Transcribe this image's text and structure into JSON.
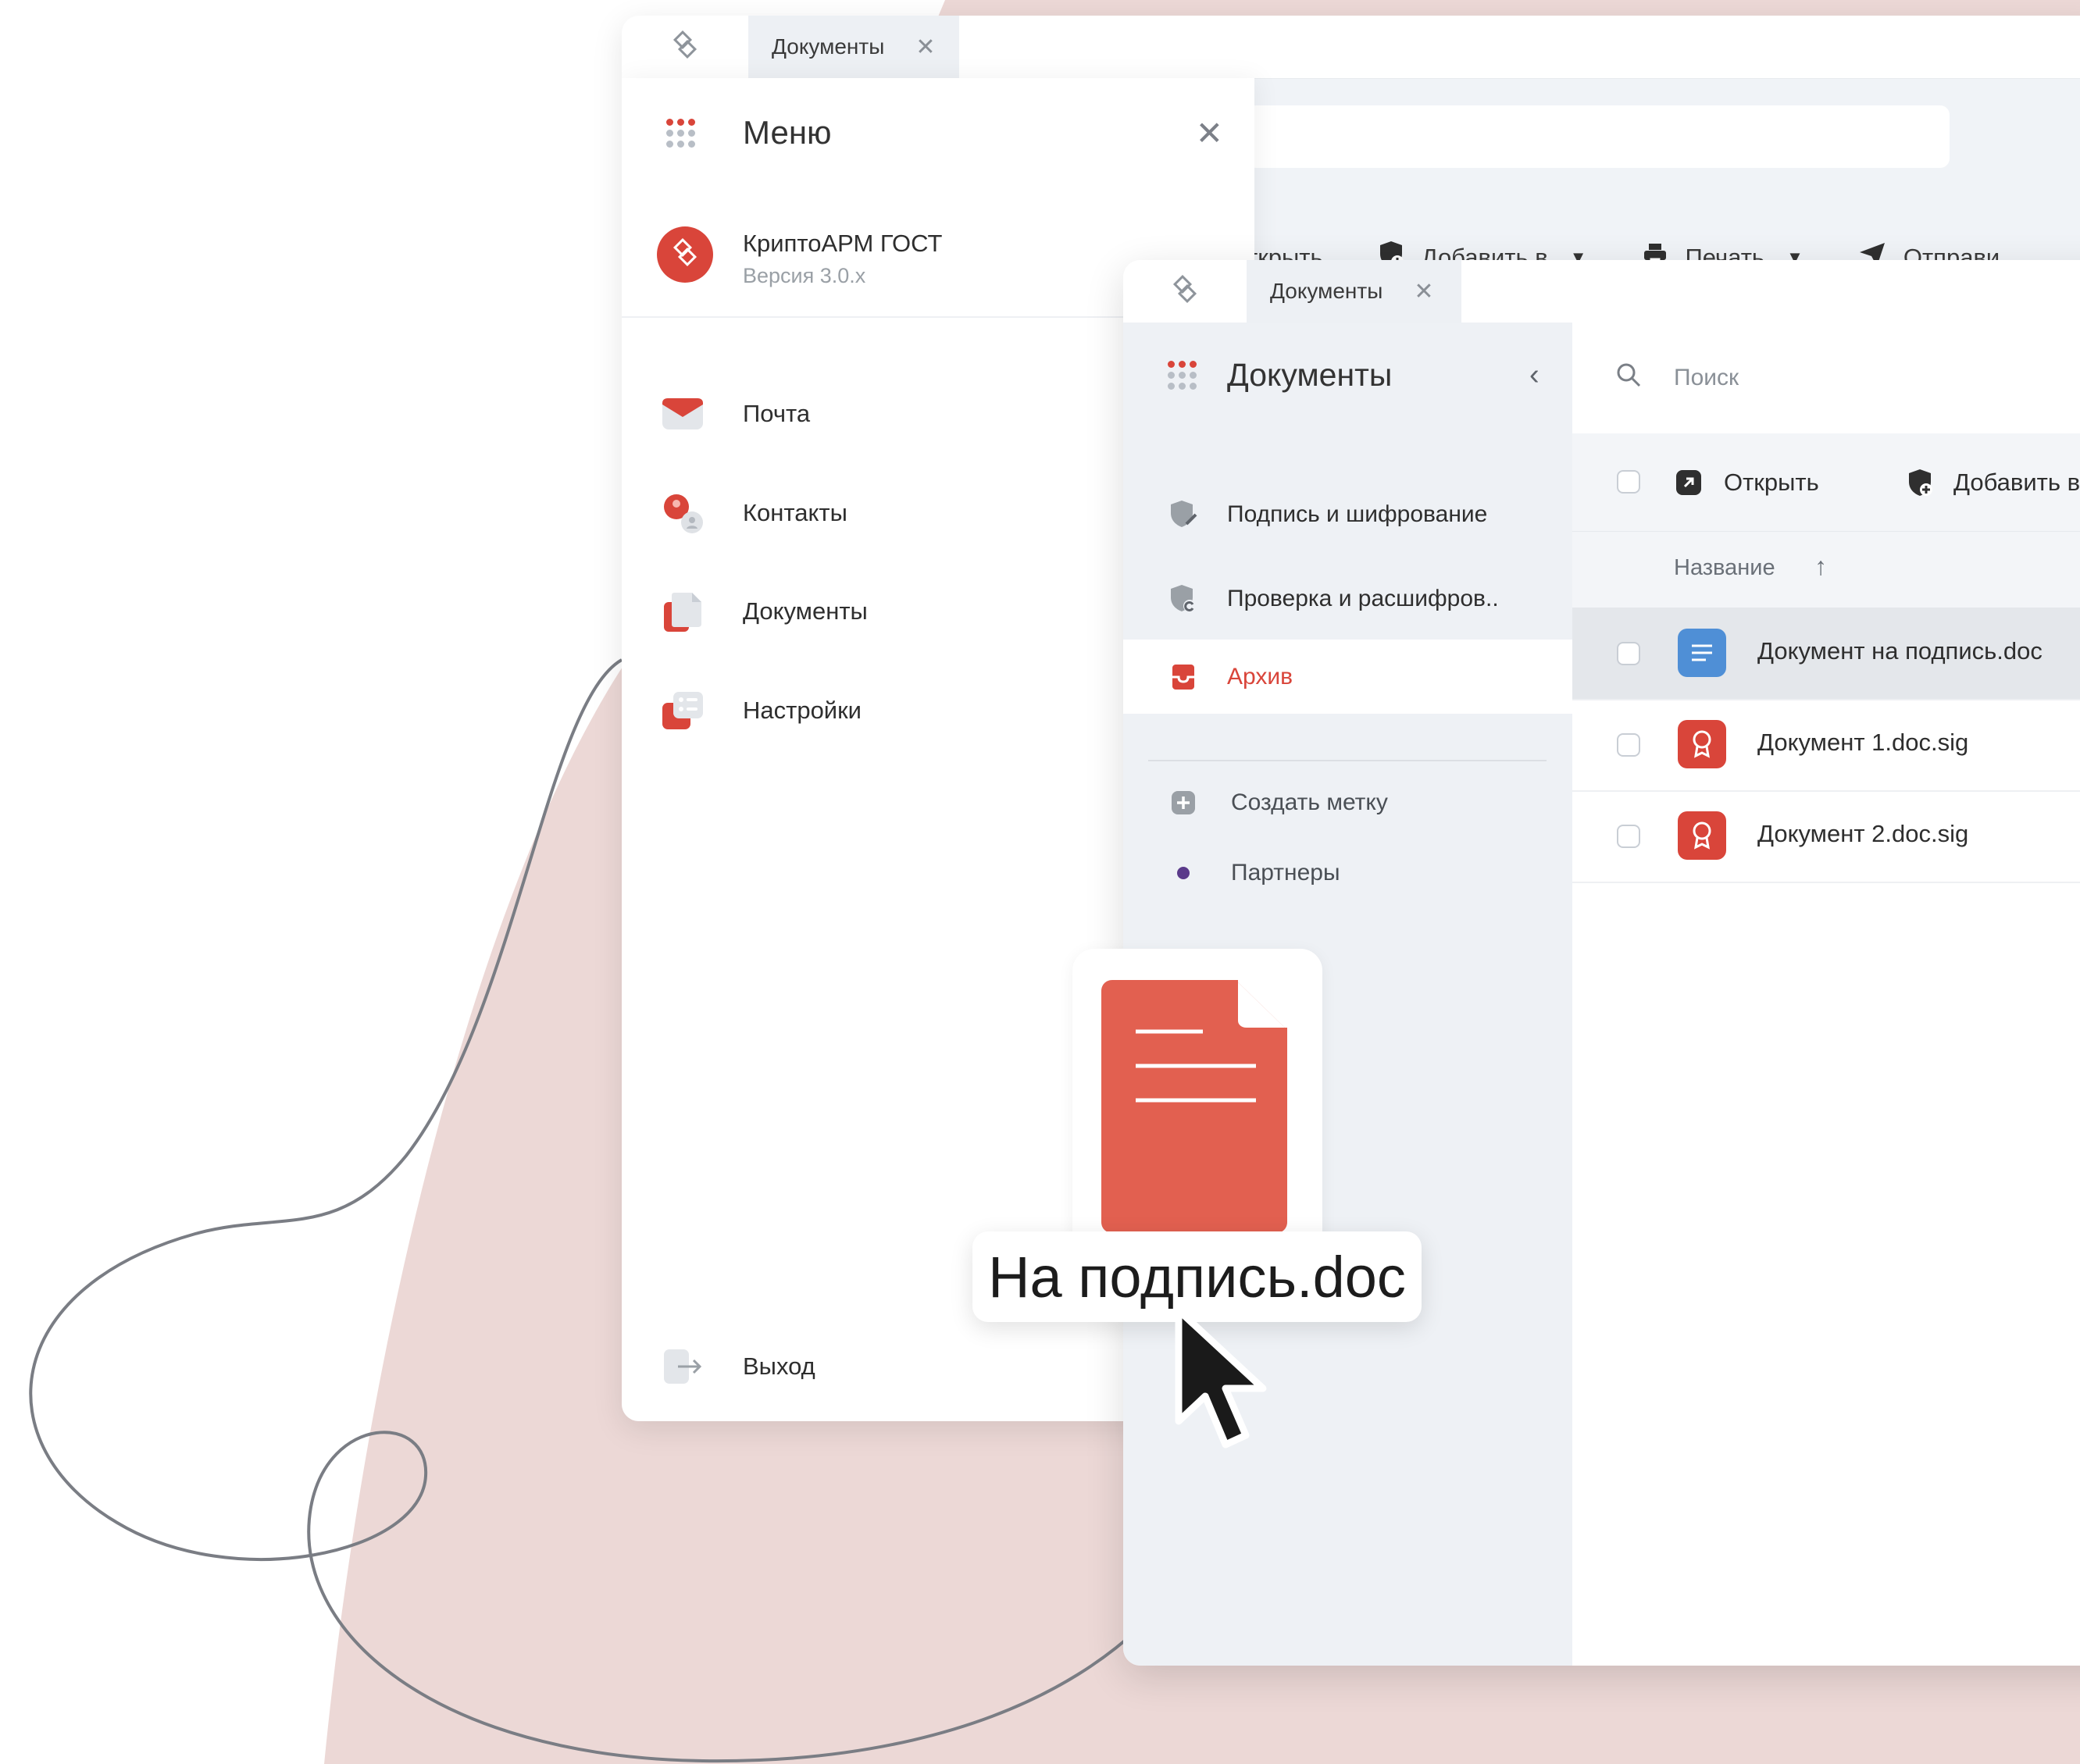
{
  "colors": {
    "accent": "#d9453a",
    "blob": "#ecd8d6",
    "doc_blue": "#4f8fd6",
    "doc_red": "#d9453a",
    "label_purple": "#5a3a8a"
  },
  "back_window": {
    "tab": {
      "label": "Документы",
      "close_icon": "close-icon"
    },
    "toolbar": {
      "open_label": "ткрыть",
      "add_label": "Добавить в",
      "print_label": "Печать",
      "send_label": "Отправи"
    }
  },
  "menu": {
    "title": "Меню",
    "app": {
      "name": "КриптоАРМ ГОСТ",
      "version": "Версия 3.0.x"
    },
    "items": [
      {
        "label": "Почта",
        "icon": "mail-icon"
      },
      {
        "label": "Контакты",
        "icon": "contacts-icon"
      },
      {
        "label": "Документы",
        "icon": "documents-icon"
      },
      {
        "label": "Настройки",
        "icon": "settings-icon"
      }
    ],
    "logout_label": "Выход"
  },
  "front_window": {
    "tab": {
      "label": "Документы"
    },
    "sidebar": {
      "title": "Документы",
      "items": [
        {
          "label": "Подпись и шифрование",
          "icon": "shield-sign-icon"
        },
        {
          "label": "Проверка и расшифров..",
          "icon": "shield-check-icon"
        },
        {
          "label": "Архив",
          "icon": "archive-icon",
          "active": true
        }
      ],
      "labels": [
        {
          "label": "Создать метку",
          "icon": "plus-icon"
        },
        {
          "label": "Партнеры",
          "icon": "dot-icon"
        }
      ]
    },
    "search": {
      "placeholder": "Поиск"
    },
    "toolbar": {
      "open_label": "Открыть",
      "add_label": "Добавить в"
    },
    "table": {
      "column_name": "Название",
      "sort": "ascending",
      "rows": [
        {
          "name": "Документ на подпись.doc",
          "type": "doc",
          "selected": true
        },
        {
          "name": "Документ 1.doc.sig",
          "type": "sig"
        },
        {
          "name": "Документ 2.doc.sig",
          "type": "sig"
        }
      ]
    }
  },
  "drag": {
    "file_label": "На подпись.doc"
  }
}
